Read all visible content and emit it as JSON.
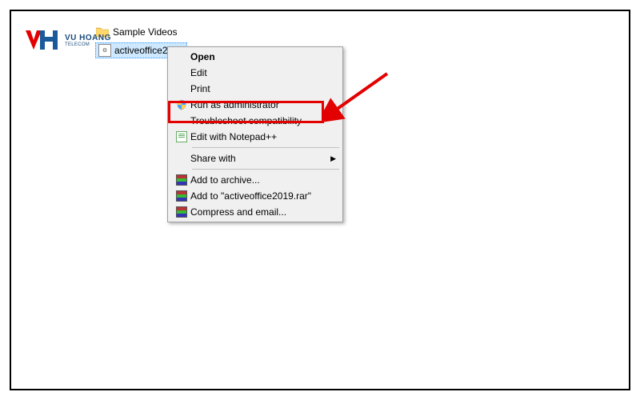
{
  "logo": {
    "name": "VU HOANG",
    "sub": "TELECOM"
  },
  "folder": {
    "name": "Sample Videos"
  },
  "selected_file": {
    "name": "activeoffice2019"
  },
  "context_menu": {
    "open": "Open",
    "edit": "Edit",
    "print": "Print",
    "run_admin": "Run as administrator",
    "troubleshoot": "Troubleshoot compatibility",
    "edit_npp": "Edit with Notepad++",
    "share_with": "Share with",
    "add_archive": "Add to archive...",
    "add_to_rar": "Add to \"activeoffice2019.rar\"",
    "compress_email": "Compress and email..."
  }
}
